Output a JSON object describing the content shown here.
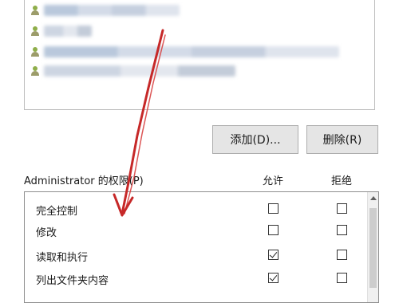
{
  "buttons": {
    "add_label": "添加(D)...",
    "remove_label": "删除(R)"
  },
  "permissions": {
    "title": "Administrator 的权限(P)",
    "allow_header": "允许",
    "deny_header": "拒绝",
    "rows": [
      {
        "label": "完全控制",
        "allow": false,
        "deny": false
      },
      {
        "label": "修改",
        "allow": false,
        "deny": false
      },
      {
        "label": "读取和执行",
        "allow": true,
        "deny": false
      },
      {
        "label": "列出文件夹内容",
        "allow": true,
        "deny": false
      }
    ]
  },
  "colors": {
    "annotation_arrow": "#c62828",
    "button_bg": "#e5e5e5"
  }
}
